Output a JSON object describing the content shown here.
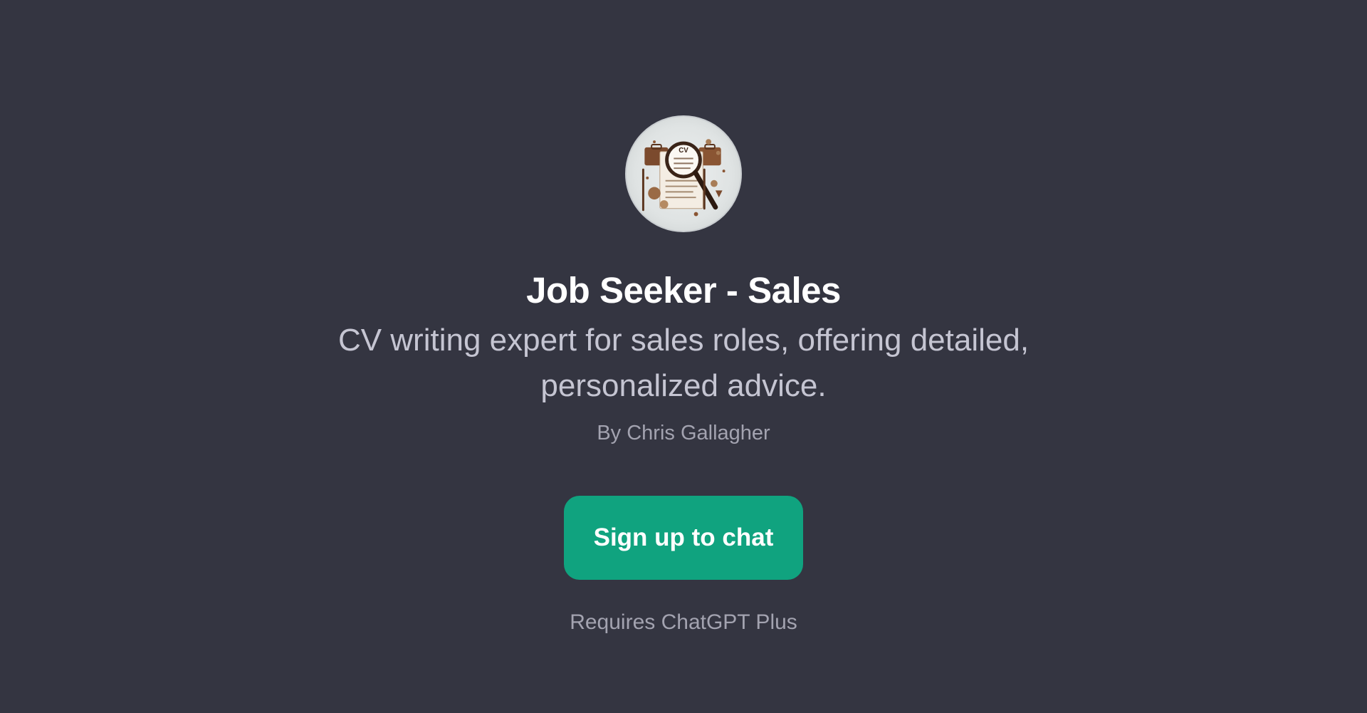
{
  "gpt": {
    "avatar_icon": "cv-magnifier-icon",
    "title": "Job Seeker - Sales",
    "description": "CV writing expert for sales roles, offering detailed, personalized advice.",
    "author": "By Chris Gallagher",
    "avatar_label": "CV"
  },
  "actions": {
    "signup_label": "Sign up to chat",
    "requires_note": "Requires ChatGPT Plus"
  },
  "colors": {
    "background": "#343541",
    "accent": "#10a37f",
    "title": "#ffffff",
    "description": "#c5c5d2",
    "muted": "#a3a3b0"
  }
}
